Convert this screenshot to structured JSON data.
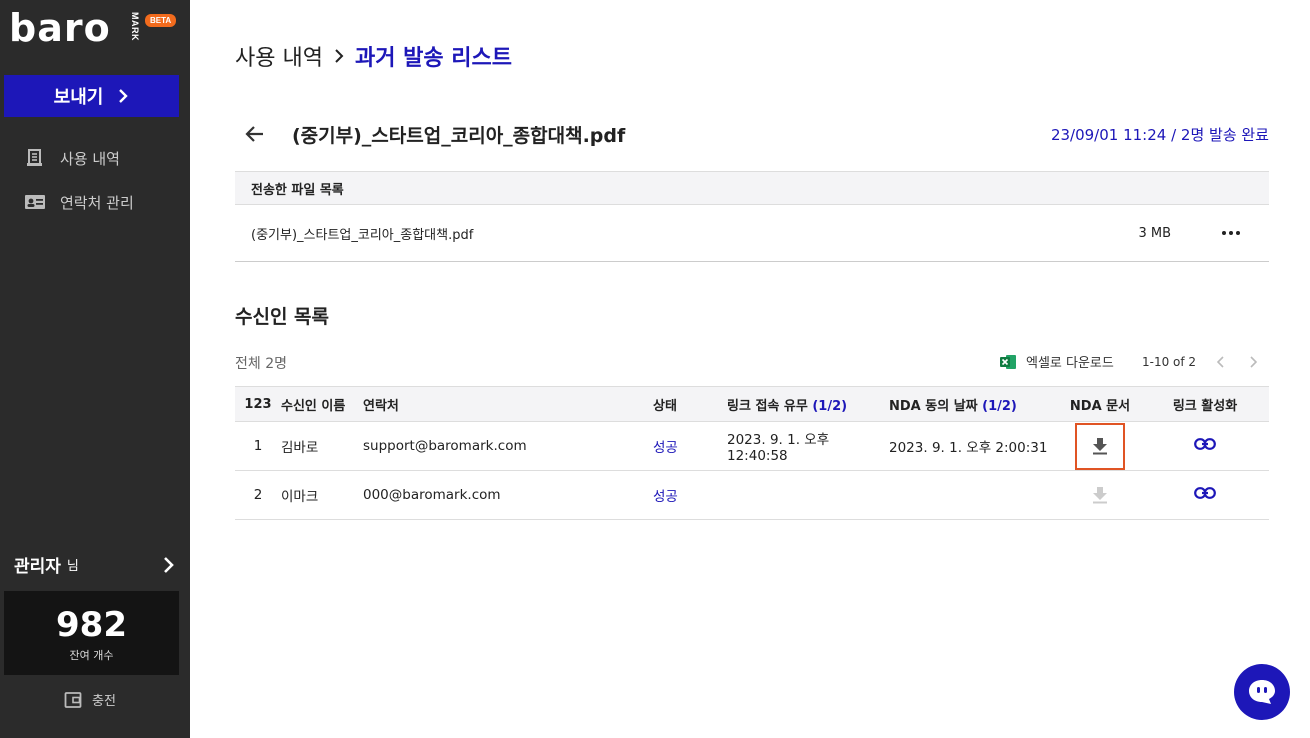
{
  "brand": {
    "logo_text": "baro",
    "logo_vertical": "MARK",
    "beta": "BETA"
  },
  "sidebar": {
    "send_label": "보내기",
    "nav": [
      {
        "label": "사용 내역",
        "icon": "receipt-icon"
      },
      {
        "label": "연락처 관리",
        "icon": "contact-card-icon"
      }
    ],
    "admin_name": "관리자",
    "admin_suffix": "님",
    "remaining_count": "982",
    "remaining_label": "잔여 개수",
    "charge_label": "충전"
  },
  "breadcrumb": {
    "parent": "사용 내역",
    "current": "과거 발송 리스트"
  },
  "file_header": {
    "title": "(중기부)_스타트업_코리아_종합대책.pdf",
    "sent_info": "23/09/01 11:24 / 2명 발송 완료"
  },
  "files_section": {
    "header": "전송한 파일 목록",
    "files": [
      {
        "name": "(중기부)_스타트업_코리아_종합대책.pdf",
        "size": "3 MB"
      }
    ]
  },
  "recipients": {
    "title": "수신인 목록",
    "total": "전체 2명",
    "excel_label": "엑셀로 다운로드",
    "pager": "1-10 of 2",
    "columns": {
      "num": "123",
      "name": "수신인 이름",
      "contact": "연락처",
      "status": "상태",
      "access": "링크 접속 유무",
      "access_count": "(1/2)",
      "nda_date": "NDA 동의 날짜",
      "nda_count": "(1/2)",
      "nda_doc": "NDA 문서",
      "link": "링크 활성화"
    },
    "rows": [
      {
        "num": "1",
        "name": "김바로",
        "contact": "support@baromark.com",
        "status": "성공",
        "access": "2023. 9. 1. 오후 12:40:58",
        "nda_date": "2023. 9. 1. 오후 2:00:31"
      },
      {
        "num": "2",
        "name": "이마크",
        "contact": "000@baromark.com",
        "status": "성공",
        "access": "",
        "nda_date": ""
      }
    ]
  },
  "colors": {
    "accent": "#1d17b8",
    "sidebar_bg": "#2b2b2b",
    "highlight": "#e05424",
    "beta": "#f26b1d"
  }
}
